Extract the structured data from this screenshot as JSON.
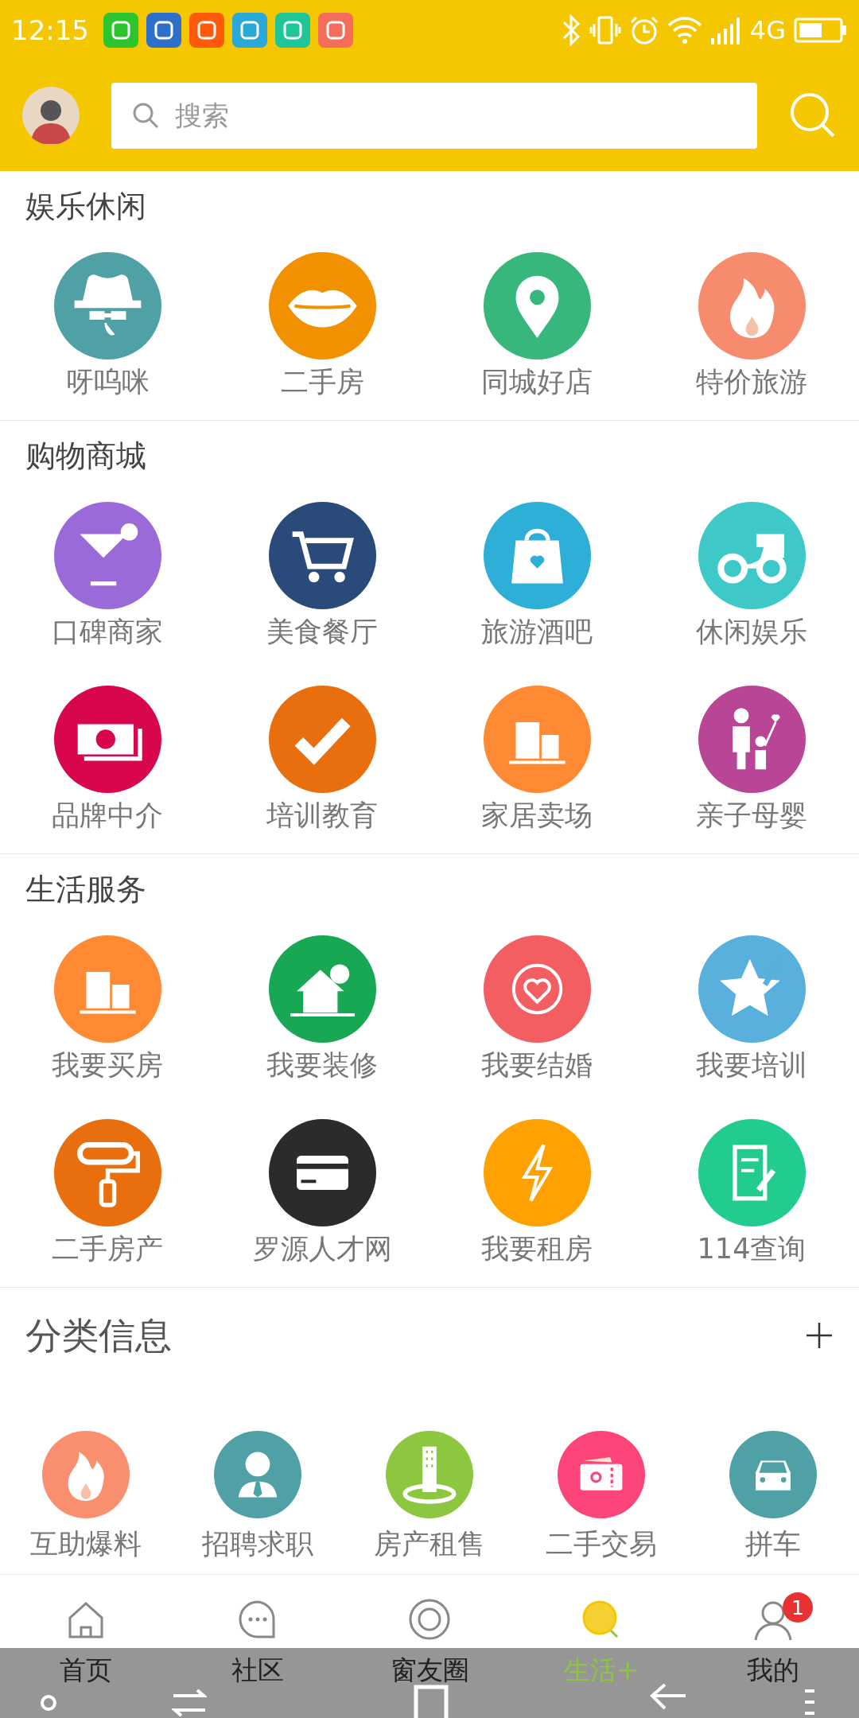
{
  "status_bar": {
    "time": "12:15",
    "network": "4G"
  },
  "header": {
    "search": {
      "placeholder": "搜索"
    }
  },
  "sections": [
    {
      "title": "娱乐休闲",
      "items": [
        {
          "label": "呀呜咪",
          "color": "#4fa1a6"
        },
        {
          "label": "二手房",
          "color": "#f29100"
        },
        {
          "label": "同城好店",
          "color": "#37b77b"
        },
        {
          "label": "特价旅游",
          "color": "#f78b6d"
        }
      ]
    },
    {
      "title": "购物商城",
      "items": [
        {
          "label": "口碑商家",
          "color": "#9a6ad9"
        },
        {
          "label": "美食餐厅",
          "color": "#2a4a7a"
        },
        {
          "label": "旅游酒吧",
          "color": "#2eafd8"
        },
        {
          "label": "休闲娱乐",
          "color": "#3ec8c8"
        },
        {
          "label": "品牌中介",
          "color": "#d7064f"
        },
        {
          "label": "培训教育",
          "color": "#e86e0e"
        },
        {
          "label": "家居卖场",
          "color": "#ff8a33"
        },
        {
          "label": "亲子母婴",
          "color": "#b94596"
        }
      ]
    },
    {
      "title": "生活服务",
      "items": [
        {
          "label": "我要买房",
          "color": "#ff8a33"
        },
        {
          "label": "我要装修",
          "color": "#18a853"
        },
        {
          "label": "我要结婚",
          "color": "#f25e61"
        },
        {
          "label": "我要培训",
          "color": "#5ab0dc"
        },
        {
          "label": "二手房产",
          "color": "#e86e0e"
        },
        {
          "label": "罗源人才网",
          "color": "#2b2b2b"
        },
        {
          "label": "我要租房",
          "color": "#ffa100"
        },
        {
          "label": "114查询",
          "color": "#22cc8f"
        }
      ]
    }
  ],
  "classifieds": {
    "title": "分类信息",
    "items": [
      {
        "label": "互助爆料",
        "color": "#f98f6f"
      },
      {
        "label": "招聘求职",
        "color": "#4fa1a6"
      },
      {
        "label": "房产租售",
        "color": "#8dc63f"
      },
      {
        "label": "二手交易",
        "color": "#fe4579"
      },
      {
        "label": "拼车",
        "color": "#4fa1a6"
      }
    ]
  },
  "tabs": [
    {
      "label": "首页",
      "selected": false
    },
    {
      "label": "社区",
      "selected": false
    },
    {
      "label": "窗友圈",
      "selected": false
    },
    {
      "label": "生活+",
      "selected": true
    },
    {
      "label": "我的",
      "selected": false,
      "badge": "1"
    }
  ]
}
